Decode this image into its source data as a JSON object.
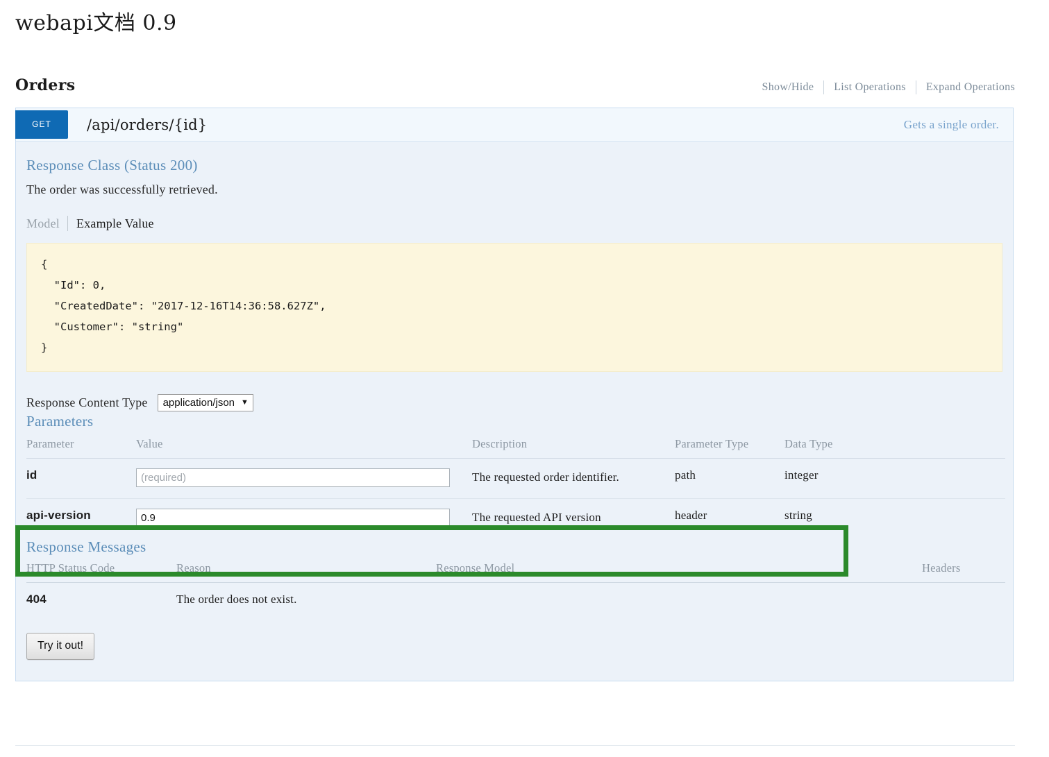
{
  "page": {
    "title": "webapi文档 0.9"
  },
  "resource": {
    "name": "Orders",
    "links": [
      {
        "label": "Show/Hide"
      },
      {
        "label": "List Operations"
      },
      {
        "label": "Expand Operations"
      }
    ]
  },
  "operation": {
    "method": "GET",
    "path": "/api/orders/{id}",
    "summary": "Gets a single order.",
    "response_class": {
      "heading": "Response Class (Status 200)",
      "description": "The order was successfully retrieved.",
      "tabs": [
        {
          "label": "Model",
          "active": false
        },
        {
          "label": "Example Value",
          "active": true
        }
      ],
      "example_value": "{\n  \"Id\": 0,\n  \"CreatedDate\": \"2017-12-16T14:36:58.627Z\",\n  \"Customer\": \"string\"\n}"
    },
    "content_type": {
      "label": "Response Content Type",
      "selected": "application/json",
      "caret": "▼",
      "options": [
        "application/json"
      ]
    },
    "parameters": {
      "heading": "Parameters",
      "columns": [
        "Parameter",
        "Value",
        "Description",
        "Parameter Type",
        "Data Type"
      ],
      "rows": [
        {
          "name": "id",
          "value": "",
          "placeholder": "(required)",
          "description": "The requested order identifier.",
          "param_type": "path",
          "data_type": "integer",
          "highlighted": false
        },
        {
          "name": "api-version",
          "value": "0.9",
          "placeholder": "",
          "description": "The requested API version",
          "param_type": "header",
          "data_type": "string",
          "highlighted": true
        }
      ]
    },
    "response_messages": {
      "heading": "Response Messages",
      "columns": [
        "HTTP Status Code",
        "Reason",
        "Response Model",
        "Headers"
      ],
      "rows": [
        {
          "code": "404",
          "reason": "The order does not exist.",
          "model": "",
          "headers": ""
        }
      ]
    },
    "try_it_out": "Try it out!"
  },
  "annotation": {
    "highlight_color": "#2b8a2b"
  }
}
